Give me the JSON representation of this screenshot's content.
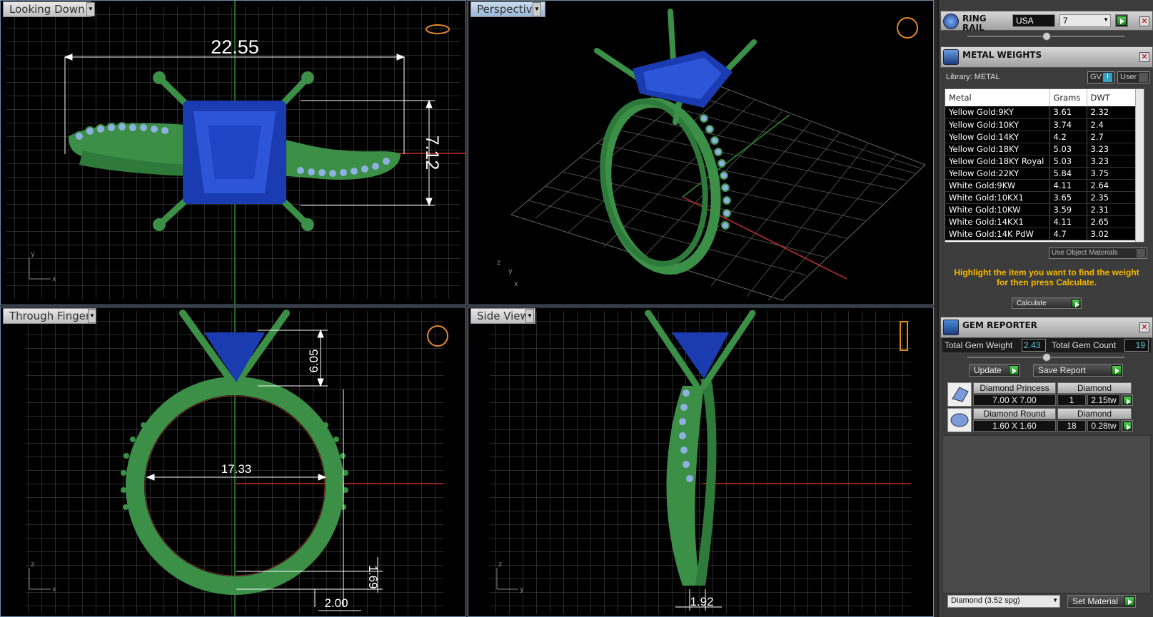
{
  "viewports": {
    "top_left": {
      "label": "Looking Down",
      "dims": [
        "22.55",
        "7.12"
      ]
    },
    "top_right": {
      "label": "Perspective"
    },
    "bottom_left": {
      "label": "Through Finger",
      "dims": [
        "6.05",
        "17.33",
        "1.69",
        "2.00"
      ]
    },
    "bottom_right": {
      "label": "Side View",
      "dims": [
        "1.92"
      ]
    }
  },
  "ring_rail": {
    "title": "RING RAIL",
    "region": "USA",
    "size": "7"
  },
  "metal_weights": {
    "title": "METAL WEIGHTS",
    "library": "Library: METAL",
    "gv_label": "GV",
    "gv_toggle": "I",
    "user_label": "User",
    "columns": [
      "Metal",
      "Grams",
      "DWT"
    ],
    "rows": [
      [
        "Yellow Gold:9KY",
        "3.61",
        "2.32"
      ],
      [
        "Yellow Gold:10KY",
        "3.74",
        "2.4"
      ],
      [
        "Yellow Gold:14KY",
        "4.2",
        "2.7"
      ],
      [
        "Yellow Gold:18KY",
        "5.03",
        "3.23"
      ],
      [
        "Yellow Gold:18KY Royal",
        "5.03",
        "3.23"
      ],
      [
        "Yellow Gold:22KY",
        "5.84",
        "3.75"
      ],
      [
        "White Gold:9KW",
        "4.11",
        "2.64"
      ],
      [
        "White Gold:10KX1",
        "3.65",
        "2.35"
      ],
      [
        "White Gold:10KW",
        "3.59",
        "2.31"
      ],
      [
        "White Gold:14KX1",
        "4.11",
        "2.65"
      ],
      [
        "White Gold:14K PdW",
        "4.7",
        "3.02"
      ]
    ],
    "use_object_materials": "Use Object Materials",
    "hint": "Highlight the item you want to find the weight for then press Calculate.",
    "calculate": "Calculate"
  },
  "gem_reporter": {
    "title": "GEM REPORTER",
    "total_weight_label": "Total Gem Weight",
    "total_weight": "2.43",
    "total_count_label": "Total Gem Count",
    "total_count": "19",
    "update": "Update",
    "save_report": "Save Report",
    "gems": [
      {
        "name": "Diamond Princess",
        "material": "Diamond",
        "size": "7.00 X 7.00",
        "count": "1",
        "tw": "2.15tw"
      },
      {
        "name": "Diamond Round",
        "material": "Diamond",
        "size": "1.60 X 1.60",
        "count": "18",
        "tw": "0.28tw"
      }
    ],
    "material_select": "Diamond     (3.52 spg)",
    "set_material": "Set Material"
  }
}
